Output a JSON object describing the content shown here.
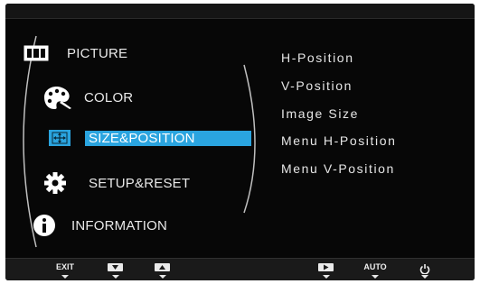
{
  "main_menu": {
    "items": [
      {
        "label": "PICTURE",
        "icon": "picture-icon"
      },
      {
        "label": "COLOR",
        "icon": "palette-icon"
      },
      {
        "label": "SIZE&POSITION",
        "icon": "move-arrows-icon",
        "selected": true
      },
      {
        "label": "SETUP&RESET",
        "icon": "gear-icon"
      },
      {
        "label": "INFORMATION",
        "icon": "info-icon"
      }
    ]
  },
  "sub_menu": {
    "items": [
      "H-Position",
      "V-Position",
      "Image Size",
      "Menu H-Position",
      "Menu V-Position"
    ]
  },
  "button_bar": {
    "exit_label": "EXIT",
    "auto_label": "AUTO",
    "buttons": [
      "exit",
      "down",
      "up",
      "enter",
      "auto",
      "power"
    ]
  },
  "colors": {
    "background": "#070707",
    "selection": "#2aa4df",
    "text": "#e9e9e9"
  }
}
